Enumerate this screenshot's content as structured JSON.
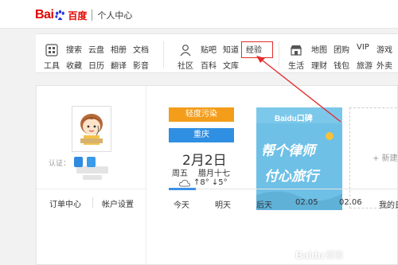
{
  "header": {
    "logo_bai": "Bai",
    "logo_du": "du",
    "logo_cn": "百度",
    "title": "个人中心"
  },
  "services": {
    "group1_icon": "grid-icon",
    "group1_icon_label": "工具",
    "group1_row1": [
      "搜索",
      "云盘",
      "相册",
      "文档"
    ],
    "group1_row2": [
      "收藏",
      "日历",
      "翻译",
      "影音"
    ],
    "group2_icon": "person-icon",
    "group2_icon_label": "社区",
    "group2_row1": [
      "贴吧",
      "知道",
      "经验"
    ],
    "group2_row2": [
      "百科",
      "文库"
    ],
    "group3_icon": "store-icon",
    "group3_icon_label": "生活",
    "group3_row1": [
      "地图",
      "团购",
      "VIP",
      "游戏"
    ],
    "group3_row2": [
      "理财",
      "钱包",
      "旅游",
      "外卖"
    ]
  },
  "profile": {
    "verify_label": "认证：",
    "order_center": "订单中心",
    "account_settings": "帐户设置"
  },
  "weather": {
    "pollution": "轻度污染",
    "city": "重庆",
    "date": "2月2日",
    "weekday": "周五",
    "lunar": "腊月十七",
    "temp": "↑8° ↓5°",
    "pollution_color": "#f39d1a",
    "city_color": "#2f8fe2"
  },
  "promo": {
    "logo_text": "Baidu口碑",
    "line1": "帮个律师",
    "line2": "付心旅行"
  },
  "new_card": {
    "label": "+ 新建"
  },
  "tabs": [
    "今天",
    "明天",
    "后天",
    "02.05",
    "02.06",
    "我的日"
  ],
  "watermark": {
    "brand": "Baidu",
    "suffix": "经验"
  },
  "colors": {
    "accent_red": "#e32d2d",
    "brand_blue": "#2932e1",
    "brand_red": "#e10601"
  }
}
